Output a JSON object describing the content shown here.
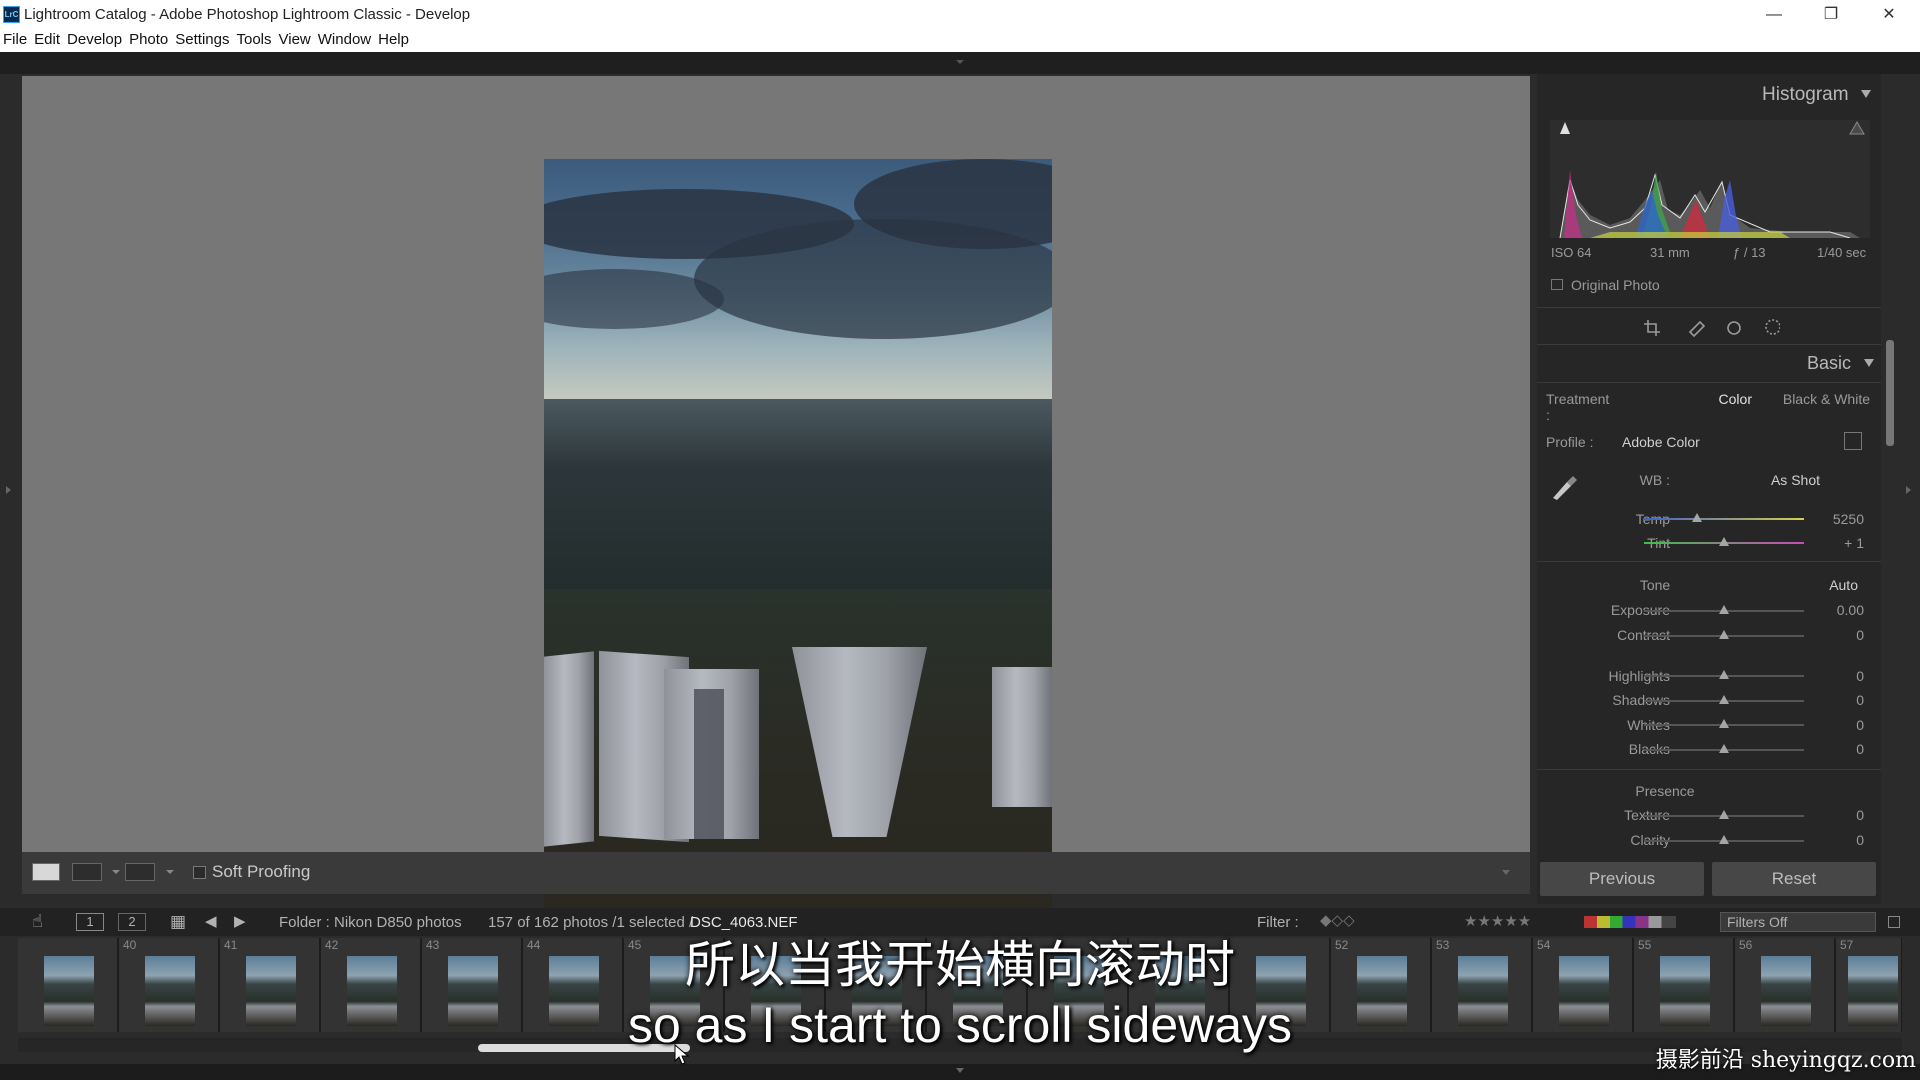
{
  "window": {
    "app_icon_text": "LrC",
    "title": "Lightroom Catalog - Adobe Photoshop Lightroom Classic - Develop",
    "minimize_glyph": "—",
    "restore_glyph": "❐",
    "close_glyph": "✕"
  },
  "menu": [
    "File",
    "Edit",
    "Develop",
    "Photo",
    "Settings",
    "Tools",
    "View",
    "Window",
    "Help"
  ],
  "toolbar": {
    "soft_proofing_label": "Soft Proofing",
    "soft_proofing_checked": false
  },
  "histogram": {
    "title": "Histogram",
    "iso": "ISO 64",
    "focal_length": "31 mm",
    "aperture": "ƒ / 13",
    "shutter": "1/40 sec",
    "original_photo_label": "Original Photo"
  },
  "basic": {
    "title": "Basic",
    "treatment_label": "Treatment :",
    "treatment_color": "Color",
    "treatment_bw": "Black & White",
    "profile_label": "Profile :",
    "profile_value": "Adobe Color",
    "wb_label": "WB :",
    "wb_value": "As Shot",
    "temp": {
      "label": "Temp",
      "value": "5250",
      "position": 0.33
    },
    "tint": {
      "label": "Tint",
      "value": "+ 1",
      "position": 0.5
    },
    "tone_label": "Tone",
    "auto_label": "Auto",
    "exposure": {
      "label": "Exposure",
      "value": "0.00",
      "position": 0.5
    },
    "contrast": {
      "label": "Contrast",
      "value": "0",
      "position": 0.5
    },
    "highlights": {
      "label": "Highlights",
      "value": "0",
      "position": 0.5
    },
    "shadows": {
      "label": "Shadows",
      "value": "0",
      "position": 0.5
    },
    "whites": {
      "label": "Whites",
      "value": "0",
      "position": 0.5
    },
    "blacks": {
      "label": "Blacks",
      "value": "0",
      "position": 0.5
    },
    "presence_label": "Presence",
    "texture": {
      "label": "Texture",
      "value": "0",
      "position": 0.5
    },
    "clarity": {
      "label": "Clarity",
      "value": "0",
      "position": 0.5
    }
  },
  "buttons": {
    "previous": "Previous",
    "reset": "Reset"
  },
  "filmstrip_bar": {
    "page1": "1",
    "page2": "2",
    "folder": "Folder : Nikon D850 photos",
    "count": "157 of 162 photos /1 selected /",
    "filename": "DSC_4063.NEF",
    "filter_label": "Filter :",
    "filters_off": "Filters Off"
  },
  "filmstrip": {
    "numbers": [
      "",
      "40",
      "41",
      "42",
      "43",
      "44",
      "45",
      "",
      "",
      "",
      "",
      "",
      "",
      "52",
      "53",
      "54",
      "55",
      "56",
      "57"
    ]
  },
  "subtitles": {
    "chinese": "所以当我开始横向滚动时",
    "english": "so as I start to scroll sideways"
  },
  "watermark": "摄影前沿 sheyingqz.com",
  "colors": {
    "canvas_gray": "#777777",
    "panel_bg": "#262626",
    "accent_text": "#b8b8b8"
  }
}
